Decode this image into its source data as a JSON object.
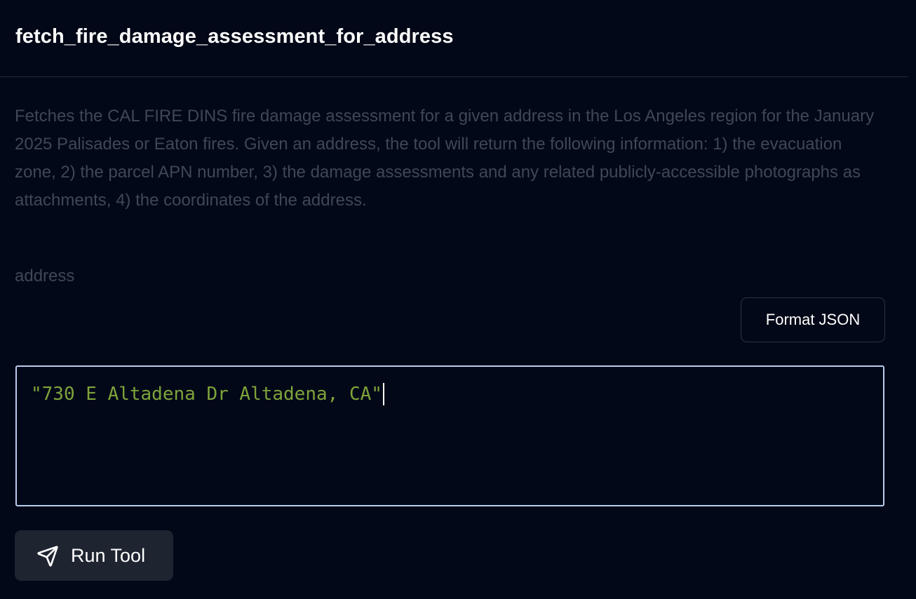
{
  "header": {
    "title": "fetch_fire_damage_assessment_for_address"
  },
  "tool": {
    "description": "Fetches the CAL FIRE DINS fire damage assessment for a given address in the Los Angeles region for the January 2025 Palisades or Eaton fires. Given an address, the tool will return the following information: 1) the evacuation zone, 2) the parcel APN number, 3) the damage assessments and any related publicly-accessible photographs as attachments, 4) the coordinates of the address."
  },
  "params": {
    "address_label": "address",
    "format_button_label": "Format JSON",
    "address_value": "\"730 E Altadena Dr Altadena, CA\""
  },
  "actions": {
    "run_label": "Run Tool",
    "run_icon": "send-icon"
  },
  "colors": {
    "background": "#020817",
    "muted_text": "#3f4756",
    "json_string": "#7ea33a",
    "editor_focus_border": "#b9cdef",
    "run_button_bg": "#1e2430"
  }
}
